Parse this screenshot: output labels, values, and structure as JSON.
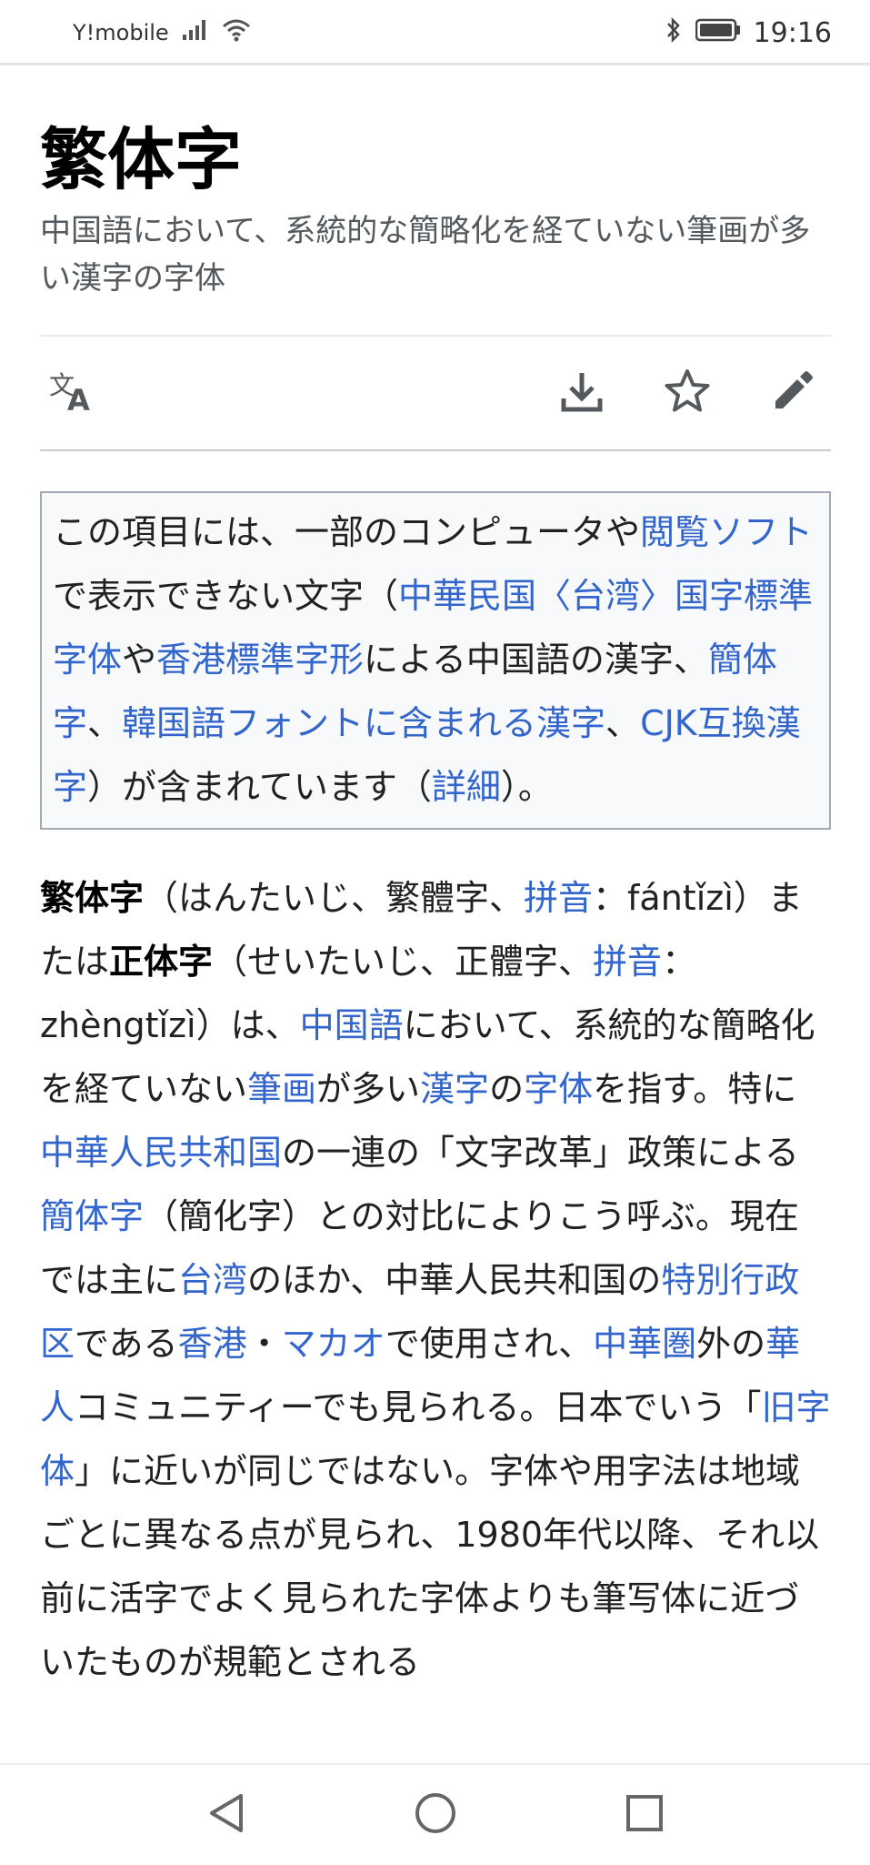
{
  "status": {
    "carrier": "Y!mobile",
    "time": "19:16",
    "icons": [
      "signal-icon",
      "wifi-icon",
      "bluetooth-icon",
      "battery-icon"
    ]
  },
  "article": {
    "title": "繁体字",
    "description": "中国語において、系統的な簡略化を経ていない筆画が多い漢字の字体"
  },
  "toolbar": {
    "icons": [
      "translate-icon",
      "download-icon",
      "star-icon",
      "edit-icon"
    ]
  },
  "notice": {
    "t1": "この項目には、一部のコンピュータや",
    "l1": "閲覧ソフト",
    "t2": "で表示できない文字（",
    "l2": "中華民国〈台湾〉国字標準字体",
    "t3": "や",
    "l3": "香港標準字形",
    "t4": "による中国語の漢字、",
    "l4": "簡体字",
    "t5": "、",
    "l5": "韓国語フォントに含まれる漢字",
    "t6": "、",
    "l6": "CJK互換漢字",
    "t7": "）が含まれています（",
    "l7": "詳細",
    "t8": "）。"
  },
  "body": {
    "b1": "繁体字",
    "t1": "（はんたいじ、繁體字、",
    "l1": "拼音",
    "t2": "：fántǐzì）または",
    "b2": "正体字",
    "t3": "（せいたいじ、正體字、",
    "l2": "拼音",
    "t4": "：zhèngtǐzì）は、",
    "l3": "中国語",
    "t5": "において、系統的な簡略化を経ていない",
    "l4": "筆画",
    "t6": "が多い",
    "l5": "漢字",
    "t7": "の",
    "l6": "字体",
    "t8": "を指す。特に",
    "l7": "中華人民共和国",
    "t9": "の一連の「文字改革」政策による",
    "l8": "簡体字",
    "t10": "（簡化字）との対比によりこう呼ぶ。現在では主に",
    "l9": "台湾",
    "t11": "のほか、中華人民共和国の",
    "l10": "特別行政区",
    "t12": "である",
    "l11": "香港",
    "t13": "・",
    "l12": "マカオ",
    "t14": "で使用され、",
    "l13": "中華圏",
    "t15": "外の",
    "l14": "華人",
    "t16": "コミュニティーでも見られる。日本でいう「",
    "l15": "旧字体",
    "t17": "」に近いが同じではない。字体や用字法は地域ごとに異なる点が見られ、1980年代以降、それ以前に活字でよく見られた字体よりも筆写体に近づいたものが規範とされる"
  },
  "navbar": {
    "icons": [
      "back-icon",
      "home-icon",
      "recents-icon"
    ]
  }
}
